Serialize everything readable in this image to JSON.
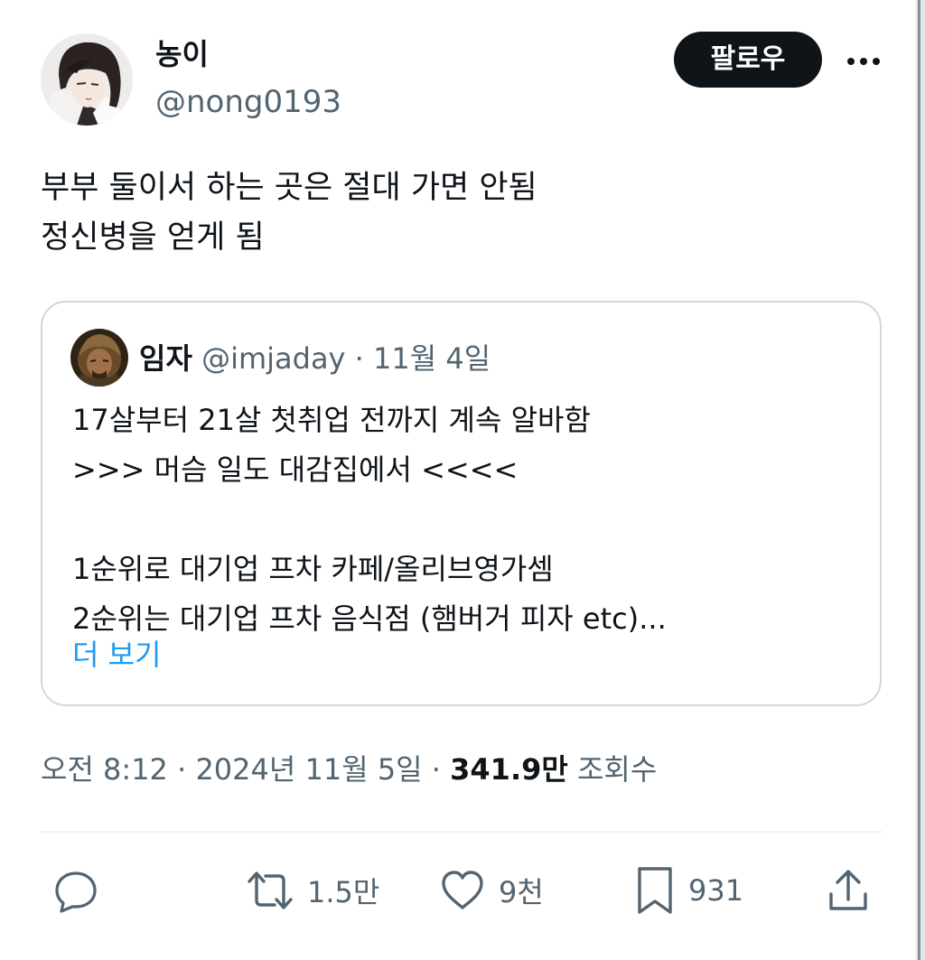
{
  "author": {
    "name": "농이",
    "handle": "@nong0193",
    "follow_label": "팔로우"
  },
  "tweet": {
    "lines": [
      "부부 둘이서 하는 곳은 절대 가면 안됨",
      "정신병을 얻게 됨"
    ]
  },
  "quote": {
    "name": "임자",
    "handle": "@imjaday",
    "separator": "·",
    "date": "11월 4일",
    "lines": [
      "17살부터 21살 첫취업 전까지 계속 알바함",
      ">>> 머슴 일도 대감집에서 <<<<",
      "",
      "1순위로 대기업 프차 카페/올리브영가셈",
      "2순위는 대기업 프차 음식점 (햄버거 피자 etc)..."
    ],
    "show_more": "더 보기"
  },
  "meta": {
    "time": "오전 8:12",
    "sep1": "·",
    "date": "2024년 11월 5일",
    "sep2": "·",
    "views_count": "341.9만",
    "views_label": "조회수"
  },
  "actions": {
    "retweets": "1.5만",
    "likes": "9천",
    "bookmarks": "931"
  },
  "colors": {
    "text": "#0f1419",
    "secondary": "#536471",
    "link": "#1d9bf0",
    "border": "#cfd9de",
    "follow_bg": "#0f1419"
  },
  "icons": [
    "more-icon",
    "reply-icon",
    "retweet-icon",
    "like-icon",
    "bookmark-icon",
    "share-icon"
  ]
}
